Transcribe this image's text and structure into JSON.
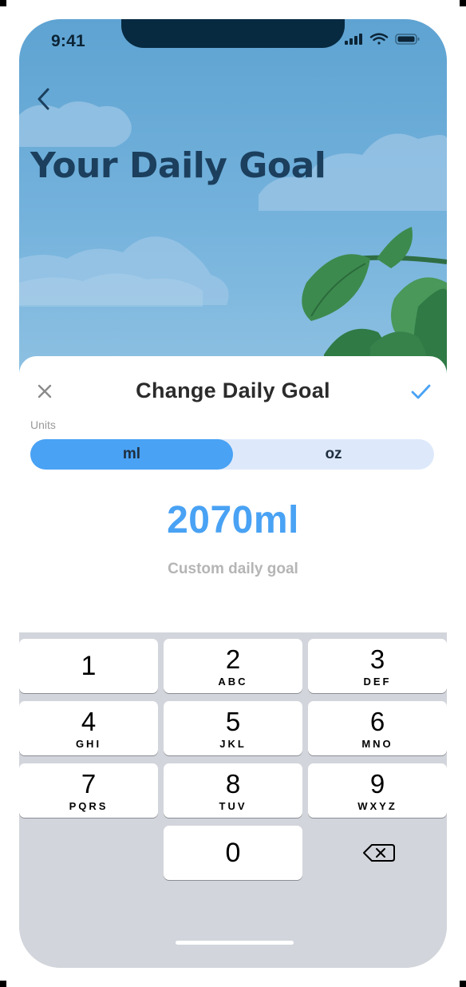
{
  "status_bar": {
    "time": "9:41"
  },
  "hero": {
    "title": "Your Daily Goal"
  },
  "sheet": {
    "title": "Change Daily Goal",
    "units_label": "Units",
    "units": [
      {
        "label": "ml",
        "selected": true
      },
      {
        "label": "oz",
        "selected": false
      }
    ],
    "goal_value": "2070ml",
    "goal_caption": "Custom daily goal"
  },
  "keypad": {
    "keys": [
      {
        "digit": "1",
        "letters": ""
      },
      {
        "digit": "2",
        "letters": "ABC"
      },
      {
        "digit": "3",
        "letters": "DEF"
      },
      {
        "digit": "4",
        "letters": "GHI"
      },
      {
        "digit": "5",
        "letters": "JKL"
      },
      {
        "digit": "6",
        "letters": "MNO"
      },
      {
        "digit": "7",
        "letters": "PQRS"
      },
      {
        "digit": "8",
        "letters": "TUV"
      },
      {
        "digit": "9",
        "letters": "WXYZ"
      },
      {
        "digit": "0",
        "letters": ""
      }
    ]
  },
  "colors": {
    "accent": "#49a2f4",
    "segment_track": "#dde9fb",
    "hero_title": "#1b3f5d",
    "keypad_bg": "#d2d5db",
    "sky": "#6aacd8",
    "leaf": "#3d8a4e"
  },
  "icons": {
    "back": "chevron-left-icon",
    "close": "close-icon",
    "confirm": "checkmark-icon",
    "delete": "backspace-icon",
    "signal": "cellular-signal-icon",
    "wifi": "wifi-icon",
    "battery": "battery-icon"
  }
}
